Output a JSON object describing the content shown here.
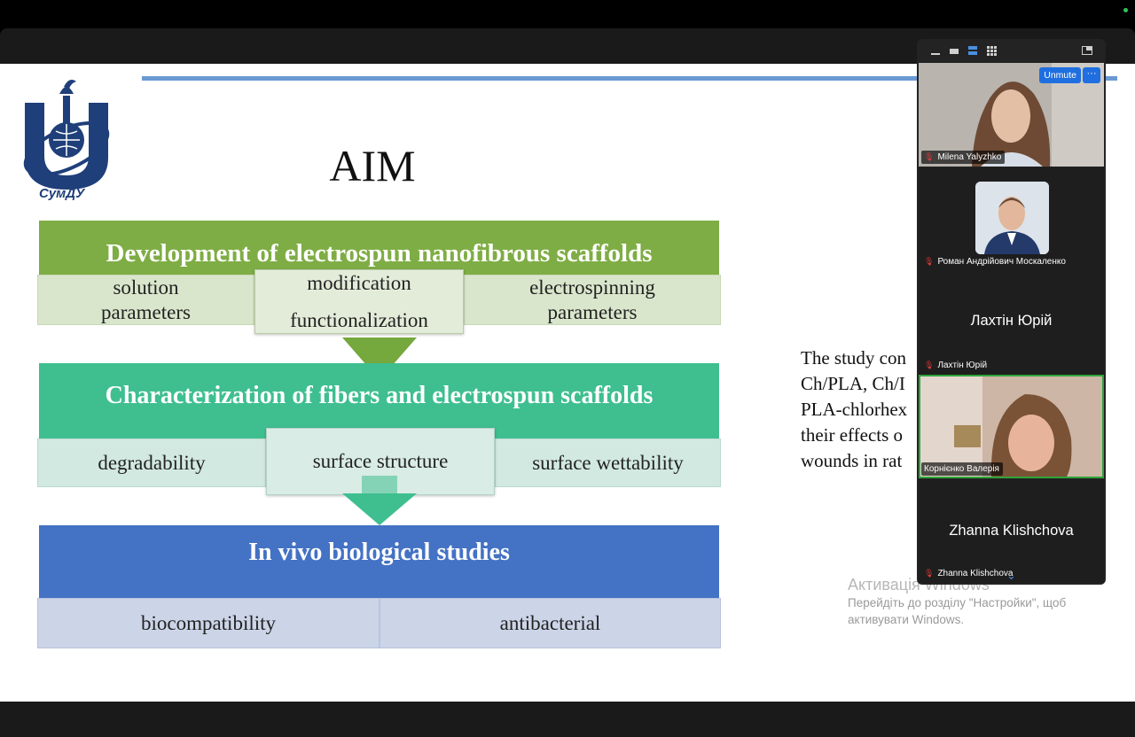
{
  "slide": {
    "logo_text": "СумДУ",
    "title": "AIM",
    "section1": {
      "heading": "Development of electrospun nanofibrous scaffolds",
      "items": [
        {
          "line1": "solution",
          "line2": "parameters"
        },
        {
          "line1": "modification",
          "line2": "functionalization"
        },
        {
          "line1": "electrospinning",
          "line2": "parameters"
        }
      ]
    },
    "section2": {
      "heading": "Characterization of fibers and electrospun scaffolds",
      "items": [
        "degradability",
        "surface structure",
        "surface wettability"
      ]
    },
    "section3": {
      "heading": "In vivo biological studies",
      "items": [
        "biocompatibility",
        "antibacterial"
      ]
    },
    "side_text": [
      "The study con",
      "Ch/PLA, Ch/I",
      "PLA-chlorhex",
      "their effects o",
      "wounds in rat"
    ]
  },
  "watermark": {
    "title": "Активація Windows",
    "line1": "Перейдіть до розділу \"Настройки\", щоб",
    "line2": "активувати Windows."
  },
  "gallery": {
    "participants": [
      {
        "name": "Milena Yalyzhko",
        "muted": true
      },
      {
        "name": "Роман Андрійович Москаленко",
        "muted": true
      },
      {
        "name": "Лахтін Юрій",
        "display": "Лахтін Юрій",
        "muted": true
      },
      {
        "name": "Корнієнко Валерія",
        "muted": false,
        "active_speaker": true
      },
      {
        "name": "Zhanna Klishchova",
        "display": "Zhanna Klishchova",
        "muted": true
      }
    ],
    "unmute_label": "Unmute",
    "more_label": "···"
  },
  "colors": {
    "green": "#7fad45",
    "teal": "#3fbf90",
    "blue": "#4472c4",
    "zoom_blue": "#1f6fe0",
    "speaker_border": "#2ea43a"
  }
}
